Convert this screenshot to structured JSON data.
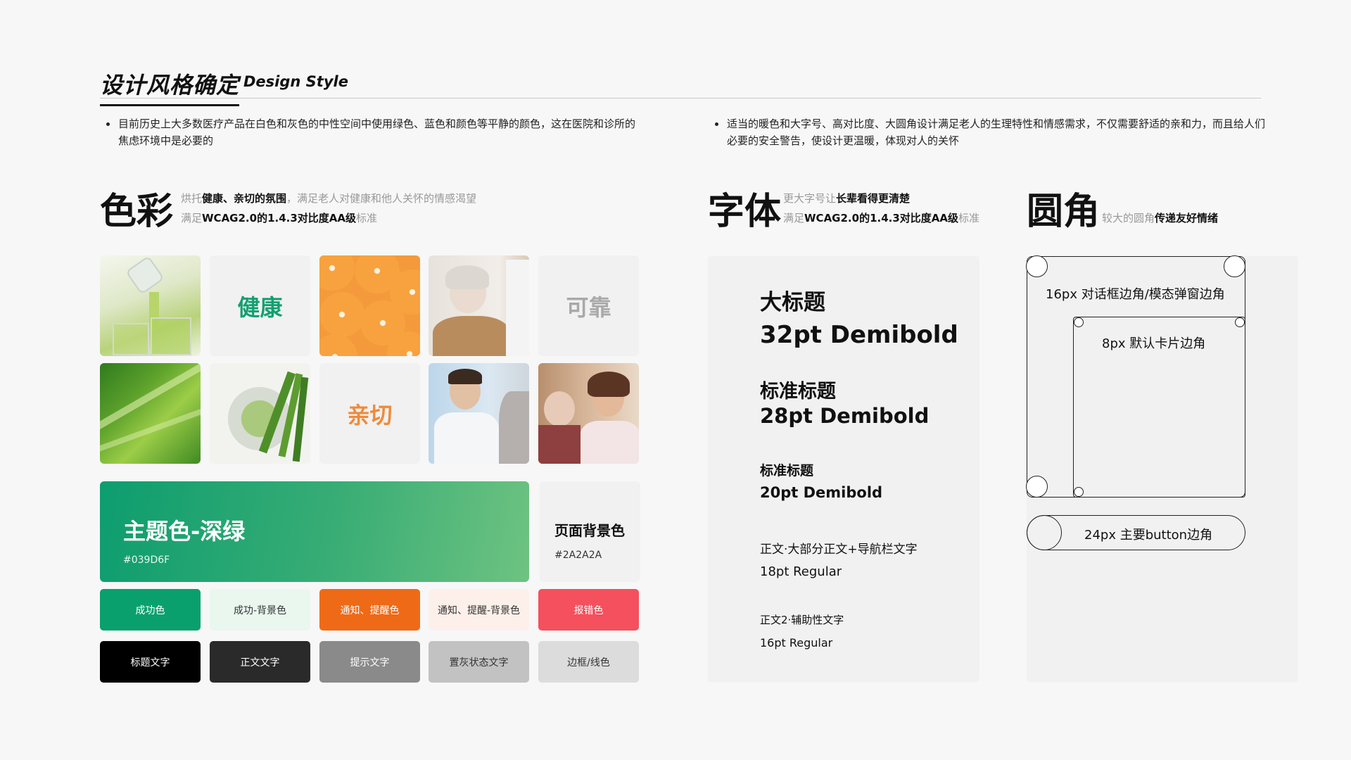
{
  "header": {
    "title_cn": "设计风格确定",
    "title_en": "Design Style"
  },
  "intro": [
    "目前历史上大多数医疗产品在白色和灰色的中性空间中使用绿色、蓝色和颜色等平静的颜色，这在医院和诊所的焦虑环境中是必要的",
    "适当的暖色和大字号、高对比度、大圆角设计满足老人的生理特性和情感需求，不仅需要舒适的亲和力，而且给人们必要的安全警告，使设计更温暖，体现对人的关怀"
  ],
  "color_section": {
    "title": "色彩",
    "line1_pre": "烘托",
    "line1_bold": "健康、亲切的氛围",
    "line1_post": "，满足老人对健康和他人关怀的情感渴望",
    "line2_pre": "满足",
    "line2_bold": "WCAG2.0的1.4.3对比度AA级",
    "line2_post": "标准"
  },
  "mood_tiles": {
    "word_health": "健康",
    "word_reliable": "可靠",
    "word_friendly": "亲切",
    "color_health": "#12a06f",
    "color_reliable": "#a9a9a9",
    "color_friendly": "#f08a3a"
  },
  "theme_color": {
    "name": "主题色-深绿",
    "hex": "#039D6F"
  },
  "page_bg": {
    "name": "页面背景色",
    "hex": "#2A2A2A"
  },
  "palette_row1": [
    {
      "label": "成功色",
      "bg": "#0aa06e",
      "fg": "#ffffff"
    },
    {
      "label": "成功-背景色",
      "bg": "#e9f7ef",
      "fg": "#333333"
    },
    {
      "label": "通知、提醒色",
      "bg": "#ef6a17",
      "fg": "#ffffff"
    },
    {
      "label": "通知、提醒-背景色",
      "bg": "#fdf0ea",
      "fg": "#333333"
    },
    {
      "label": "报错色",
      "bg": "#f5505d",
      "fg": "#ffffff"
    }
  ],
  "palette_row2": [
    {
      "label": "标题文字",
      "bg": "#000000",
      "fg": "#ffffff"
    },
    {
      "label": "正文文字",
      "bg": "#2a2a2a",
      "fg": "#ffffff"
    },
    {
      "label": "提示文字",
      "bg": "#8a8a8a",
      "fg": "#ffffff"
    },
    {
      "label": "置灰状态文字",
      "bg": "#c2c2c2",
      "fg": "#333333"
    },
    {
      "label": "边框/线色",
      "bg": "#dcdcdc",
      "fg": "#333333"
    }
  ],
  "font_section": {
    "title": "字体",
    "line1_pre": "更大字号让",
    "line1_bold": "长辈看得更清楚",
    "line2_pre": "满足",
    "line2_bold": "WCAG2.0的1.4.3对比度AA级",
    "line2_post": "标准"
  },
  "type_specs": {
    "h1_name": "大标题",
    "h1_spec": "32pt Demibold",
    "h2_name": "标准标题",
    "h2_spec": "28pt Demibold",
    "h3_name": "标准标题",
    "h3_spec": "20pt Demibold",
    "body_name": "正文·大部分正文+导航栏文字",
    "body_spec": "18pt Regular",
    "body2_name": "正文2·辅助性文字",
    "body2_spec": "16pt Regular"
  },
  "radius_section": {
    "title": "圆角",
    "desc_pre": "较大的圆角",
    "desc_bold": "传递友好情绪"
  },
  "radius_specs": {
    "dialog": "16px 对话框边角/模态弹窗边角",
    "card": "8px 默认卡片边角",
    "button": "24px 主要button边角"
  }
}
